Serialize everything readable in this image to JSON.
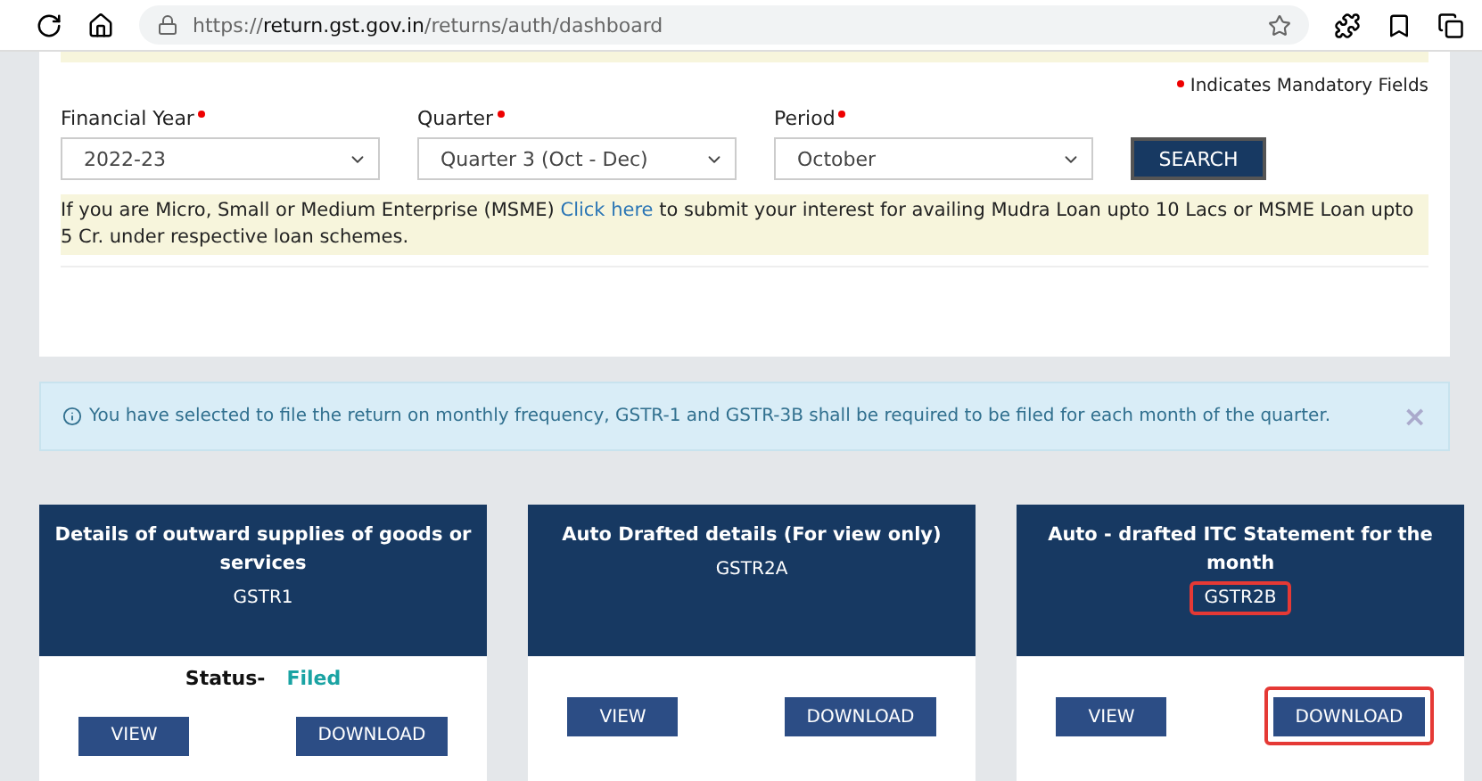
{
  "browser": {
    "url_prefix": "https://",
    "url_host": "return.gst.gov.in",
    "url_path": "/returns/auth/dashboard"
  },
  "mandatory_note": "Indicates Mandatory Fields",
  "filters": [
    {
      "label": "Financial Year",
      "value": "2022-23"
    },
    {
      "label": "Quarter",
      "value": "Quarter 3 (Oct - Dec)"
    },
    {
      "label": "Period",
      "value": "October"
    }
  ],
  "search_button": "SEARCH",
  "msme_notice": {
    "before": "If you are Micro, Small or Medium Enterprise (MSME)",
    "link": "Click here",
    "after": "to submit your interest for availing Mudra Loan upto 10 Lacs or MSME Loan upto 5 Cr. under respective loan schemes."
  },
  "info_alert": {
    "text": "You have selected to file the return on monthly frequency, GSTR-1 and GSTR-3B shall be required to be filed for each month of the quarter.",
    "close": "×"
  },
  "cards": [
    {
      "title": "Details of outward supplies of goods or services",
      "code": "GSTR1",
      "code_highlighted": false,
      "status_label": "Status-",
      "status": "Filed",
      "buttons": [
        {
          "label": "VIEW",
          "highlighted": false
        },
        {
          "label": "DOWNLOAD",
          "highlighted": false
        }
      ]
    },
    {
      "title": "Auto Drafted details (For view only)",
      "code": "GSTR2A",
      "code_highlighted": false,
      "buttons": [
        {
          "label": "VIEW",
          "highlighted": false
        },
        {
          "label": "DOWNLOAD",
          "highlighted": false
        }
      ]
    },
    {
      "title": "Auto - drafted ITC Statement for the month",
      "code": "GSTR2B",
      "code_highlighted": true,
      "buttons": [
        {
          "label": "VIEW",
          "highlighted": false
        },
        {
          "label": "DOWNLOAD",
          "highlighted": true
        }
      ]
    }
  ]
}
